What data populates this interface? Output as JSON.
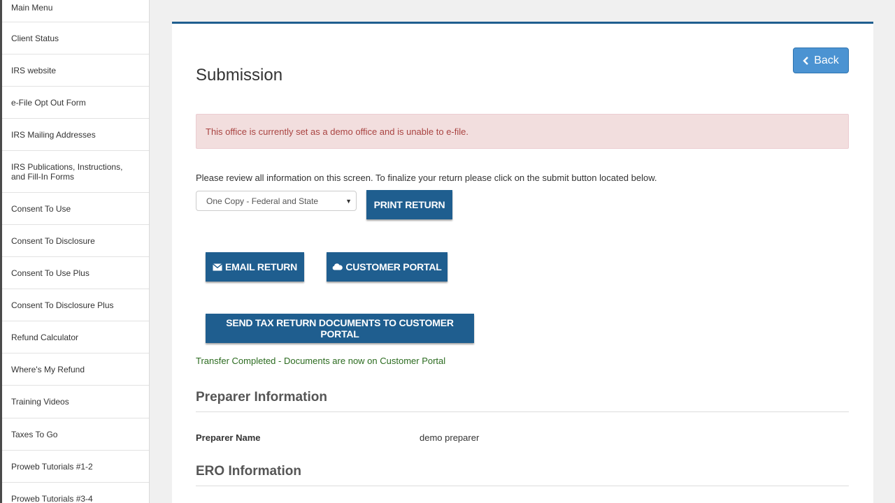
{
  "sidebar": {
    "items": [
      {
        "label": "Main Menu"
      },
      {
        "label": "Client Status"
      },
      {
        "label": "IRS website"
      },
      {
        "label": "e-File Opt Out Form"
      },
      {
        "label": "IRS Mailing Addresses"
      },
      {
        "label": "IRS Publications, Instructions, and Fill-In Forms"
      },
      {
        "label": "Consent To Use"
      },
      {
        "label": "Consent To Disclosure"
      },
      {
        "label": "Consent To Use Plus"
      },
      {
        "label": "Consent To Disclosure Plus"
      },
      {
        "label": "Refund Calculator"
      },
      {
        "label": "Where's My Refund"
      },
      {
        "label": "Training Videos"
      },
      {
        "label": "Taxes To Go"
      },
      {
        "label": "Proweb Tutorials #1-2"
      },
      {
        "label": "Proweb Tutorials #3-4"
      }
    ]
  },
  "page": {
    "title": "Submission",
    "back_label": "Back",
    "alert": "This office is currently set as a demo office and is unable to e-file.",
    "instructions": "Please review all information on this screen. To finalize your return please click on the submit button located below.",
    "print_option": "One Copy - Federal and State",
    "print_button": "PRINT RETURN",
    "email_button": "EMAIL RETURN",
    "portal_button": "CUSTOMER PORTAL",
    "send_button": "SEND TAX RETURN DOCUMENTS TO CUSTOMER PORTAL",
    "transfer_status": "Transfer Completed - Documents are now on Customer Portal"
  },
  "preparer": {
    "heading": "Preparer Information",
    "name_label": "Preparer Name",
    "name_value": "demo preparer"
  },
  "ero": {
    "heading": "ERO Information"
  },
  "icons": {
    "back": "chevron-left-icon",
    "email": "envelope-icon",
    "portal": "cloud-icon",
    "select": "caret-down-icon"
  },
  "colors": {
    "primary": "#1f5e8f",
    "back_button": "#4b93d2",
    "alert_bg": "#f2dede",
    "alert_text": "#a94442",
    "success_text": "#2b6b1f"
  }
}
